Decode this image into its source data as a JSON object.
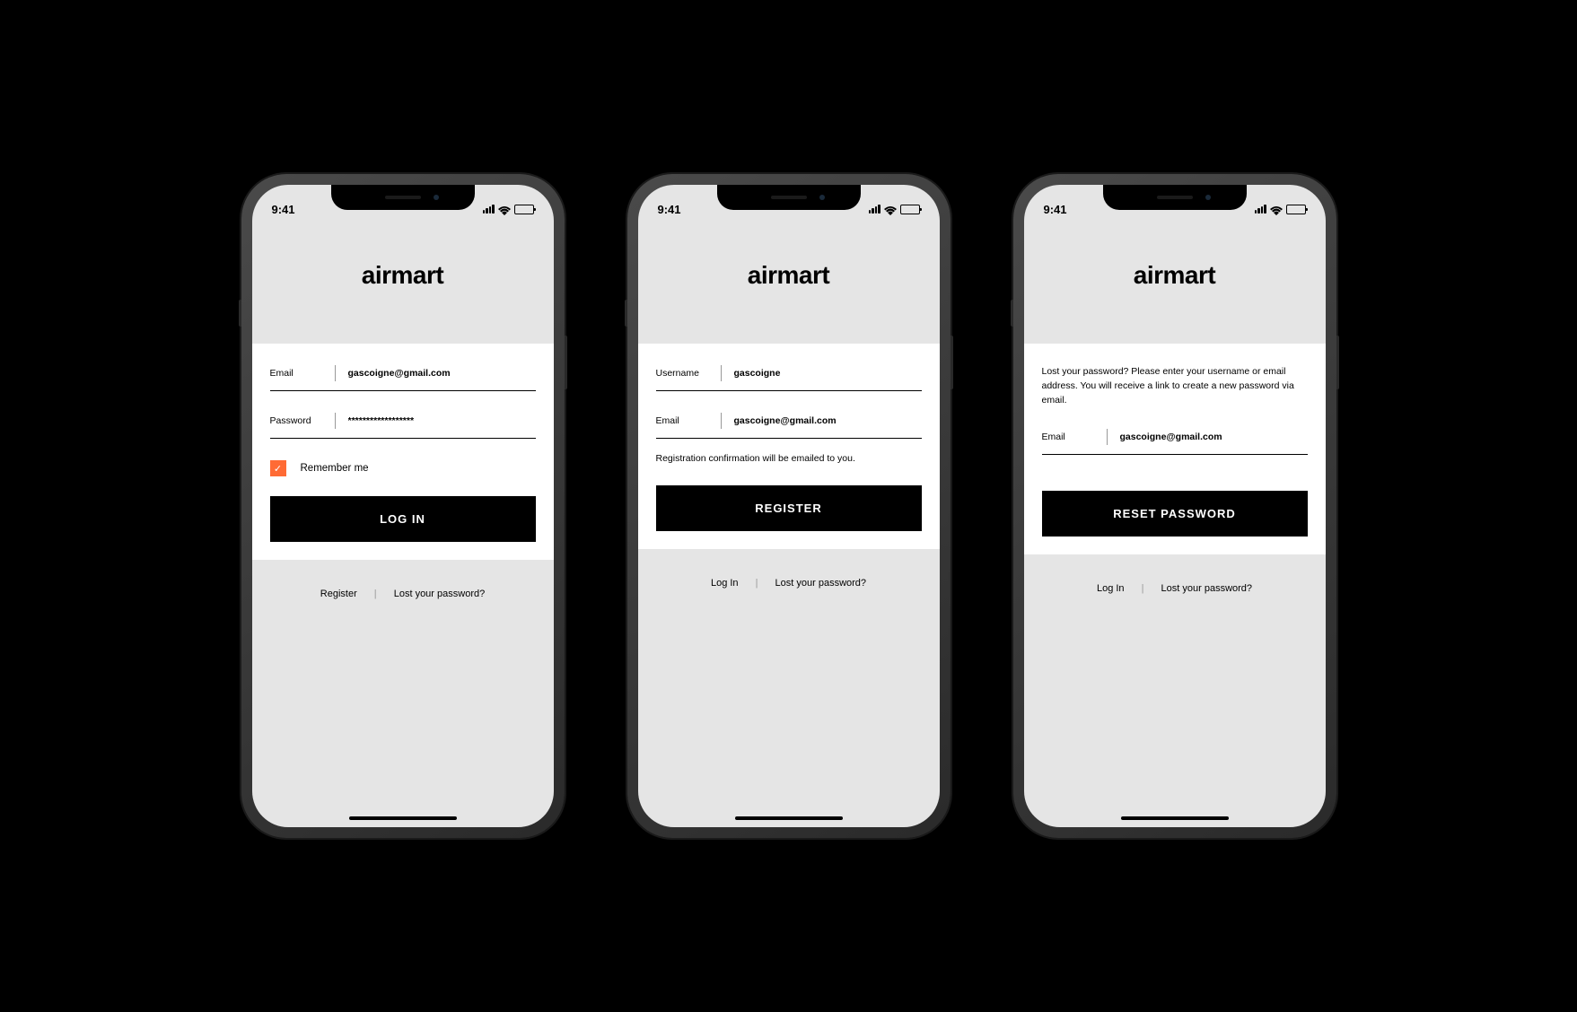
{
  "statusBar": {
    "time": "9:41"
  },
  "brand": "airmart",
  "screens": [
    {
      "id": "login",
      "fields": {
        "email": {
          "label": "Email",
          "value": "gascoigne@gmail.com"
        },
        "password": {
          "label": "Password",
          "value": "******************"
        }
      },
      "remember": {
        "label": "Remember me",
        "checked": true
      },
      "button": "LOG IN",
      "footer": {
        "link1": "Register",
        "link2": "Lost your password?"
      }
    },
    {
      "id": "register",
      "fields": {
        "username": {
          "label": "Username",
          "value": "gascoigne"
        },
        "email": {
          "label": "Email",
          "value": "gascoigne@gmail.com"
        }
      },
      "helper": "Registration confirmation will be emailed to you.",
      "button": "REGISTER",
      "footer": {
        "link1": "Log In",
        "link2": "Lost your password?"
      }
    },
    {
      "id": "reset",
      "info": "Lost your password? Please enter your username or email address. You will receive a link to create a new password via email.",
      "fields": {
        "email": {
          "label": "Email",
          "value": "gascoigne@gmail.com"
        }
      },
      "button": "RESET PASSWORD",
      "footer": {
        "link1": "Log In",
        "link2": "Lost your password?"
      }
    }
  ],
  "colors": {
    "accent": "#ff6b35",
    "background": "#e5e5e5",
    "card": "#ffffff",
    "text": "#000000"
  }
}
